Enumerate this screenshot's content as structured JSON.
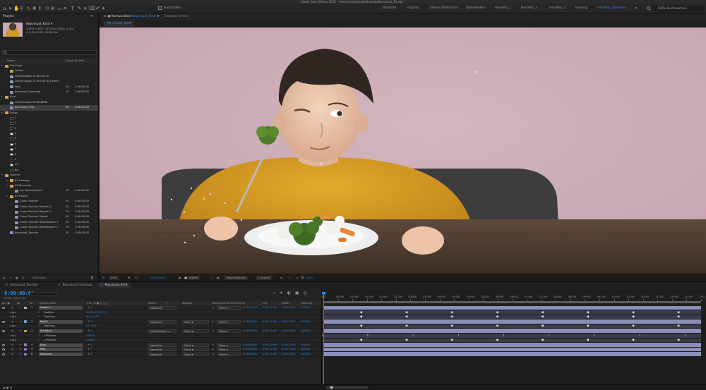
{
  "window": {
    "title": "Adobe After Effects 2020 - /Users/herbstmuth/Desktop/Keyvisual_20.aep *"
  },
  "toolbar": {
    "snapping_label": "Ausrichten",
    "workspaces": [
      "Standard",
      "Original",
      "Kleiner Bildschirm",
      "Bibliotheken",
      "HerbPro_1",
      "HerbPro_2",
      "HerbPro_3",
      "Training",
      "HerbPro_2Screens"
    ],
    "active_workspace": "HerbPro_2Screens",
    "more": "»",
    "help_placeholder": "Hilfe durchsuchen"
  },
  "project": {
    "tab_label": "Projekt",
    "menu": "≡",
    "selected_asset": {
      "name": "Keyvisual_Kind ▾",
      "dims": "10951 x 6017 (2729 x 1500) (1,00)",
      "duration": "Δ 0;00;13;00, 59,94 fps"
    },
    "columns": {
      "name": "Name",
      "fps": "Frame...",
      "start": "In-Point"
    },
    "rows": [
      {
        "label": "Flamingo",
        "type": "folder",
        "level": 0,
        "tri": "▾",
        "fps": "",
        "start": ""
      },
      {
        "label": "Farben",
        "type": "folder",
        "level": 1,
        "tri": "▸",
        "fps": "",
        "start": ""
      },
      {
        "label": "GettyImages-1176333140",
        "type": "image",
        "level": 1,
        "tri": "",
        "fps": "",
        "start": ""
      },
      {
        "label": "GettyImages-1176333140_Farben",
        "type": "image",
        "level": 1,
        "tri": "",
        "fps": "",
        "start": ""
      },
      {
        "label": "Hals",
        "type": "comp",
        "level": 1,
        "tri": "",
        "fps": "30",
        "start": "0:00:00:00"
      },
      {
        "label": "Keyvisual_Flamingo",
        "type": "comp",
        "level": 1,
        "tri": "",
        "fps": "30",
        "start": "0:00:00:00"
      },
      {
        "label": "Kind",
        "type": "folder",
        "level": 0,
        "tri": "▾",
        "fps": "",
        "start": ""
      },
      {
        "label": "GettyImages-904606666",
        "type": "image",
        "level": 1,
        "tri": "",
        "fps": "",
        "start": ""
      },
      {
        "label": "Keyvisual_Kind",
        "type": "comp",
        "level": 1,
        "tri": "",
        "fps": "30",
        "start": "0:00:00:00",
        "selected": true
      },
      {
        "label": "Solids",
        "type": "folder",
        "level": 0,
        "tri": "▾",
        "fps": "",
        "start": ""
      },
      {
        "label": "1",
        "type": "solid-dark",
        "level": 1,
        "tri": "",
        "fps": "",
        "start": ""
      },
      {
        "label": "2",
        "type": "solid-dark",
        "level": 1,
        "tri": "",
        "fps": "",
        "start": ""
      },
      {
        "label": "3",
        "type": "solid-dark",
        "level": 1,
        "tri": "",
        "fps": "",
        "start": ""
      },
      {
        "label": "4",
        "type": "solid-light",
        "level": 1,
        "tri": "",
        "fps": "",
        "start": ""
      },
      {
        "label": "5",
        "type": "solid-dark",
        "level": 1,
        "tri": "",
        "fps": "",
        "start": ""
      },
      {
        "label": "6",
        "type": "solid-light",
        "level": 1,
        "tri": "",
        "fps": "",
        "start": ""
      },
      {
        "label": "7",
        "type": "solid-light",
        "level": 1,
        "tri": "",
        "fps": "",
        "start": ""
      },
      {
        "label": "8",
        "type": "solid-light",
        "level": 1,
        "tri": "",
        "fps": "",
        "start": ""
      },
      {
        "label": "9",
        "type": "solid-dark",
        "level": 1,
        "tri": "",
        "fps": "",
        "start": ""
      },
      {
        "label": "10",
        "type": "solid-light",
        "level": 1,
        "tri": "",
        "fps": "",
        "start": ""
      },
      {
        "label": "BG",
        "type": "solid-dark",
        "level": 1,
        "tri": "",
        "fps": "",
        "start": ""
      },
      {
        "label": "Taucher",
        "type": "folder",
        "level": 0,
        "tri": "▾",
        "fps": "",
        "start": ""
      },
      {
        "label": "01 Footage",
        "type": "folder",
        "level": 1,
        "tri": "▸",
        "fps": "",
        "start": ""
      },
      {
        "label": "02 Elemente",
        "type": "folder",
        "level": 1,
        "tri": "▾",
        "fps": "",
        "start": ""
      },
      {
        "label": "Arc Wasserstrahl",
        "type": "comp",
        "level": 2,
        "tri": "",
        "fps": "30",
        "start": "0:00:00:00"
      },
      {
        "label": "03 Comps",
        "type": "folder",
        "level": 1,
        "tri": "▾",
        "fps": "",
        "start": ""
      },
      {
        "label": "Comp Taucher",
        "type": "comp",
        "level": 2,
        "tri": "",
        "fps": "30",
        "start": "0:00:00:00"
      },
      {
        "label": "Comp Taucher Ripples 1",
        "type": "comp",
        "level": 2,
        "tri": "",
        "fps": "30",
        "start": "0:00:00:00"
      },
      {
        "label": "Comp Taucher Ripples 2",
        "type": "comp",
        "level": 2,
        "tri": "",
        "fps": "30",
        "start": "0:00:00:00"
      },
      {
        "label": "Comp Taucher Splash",
        "type": "comp",
        "level": 2,
        "tri": "",
        "fps": "30",
        "start": "0:00:00:00"
      },
      {
        "label": "Comp Taucher Weisswasser 1",
        "type": "comp",
        "level": 2,
        "tri": "",
        "fps": "30",
        "start": "0:00:00:00"
      },
      {
        "label": "Comp Taucher Weisswasser 2",
        "type": "comp",
        "level": 2,
        "tri": "",
        "fps": "30",
        "start": "0:00:00:00"
      },
      {
        "label": "Keyvisual_Taucher",
        "type": "comp",
        "level": 1,
        "tri": "",
        "fps": "30",
        "start": "0:00:00:00"
      }
    ],
    "bpc": "8-Bit-Kanal"
  },
  "viewer": {
    "comp_tab_prefix": "Komposition",
    "comp_tab_name": "Keyvisual_Kind",
    "footage_tab": "Footage (ohne)",
    "comp_chip": "Keyvisual_Kind",
    "bar": {
      "zoom": "25%",
      "timecode": "0:00:00:00",
      "resolution": "Viertel",
      "camera": "Aktive Kamera",
      "views": "1 Ansicht",
      "exposure": "+0,0"
    }
  },
  "timeline": {
    "tabs": [
      {
        "label": "Keyvisual_Taucher",
        "active": false
      },
      {
        "label": "Keyvisual_Flamingo",
        "active": false
      },
      {
        "label": "Keyvisual_Kind",
        "active": true
      }
    ],
    "timecode": "0:00:00:00",
    "timecode_sub": "00000 (59,94 fps)",
    "header": {
      "num": "Nr.",
      "source": "Quellenname",
      "mode": "Modus",
      "trkmat": "BewMas",
      "parent": "Übergeordnet und verkn...",
      "in": "In",
      "out": "Out",
      "duration": "Dauer",
      "stretch": "Dehnung"
    },
    "ruler": [
      "00f",
      "00:20f",
      "01:00f",
      "01:20f",
      "02:00f",
      "02:20f",
      "03:00f",
      "03:20f",
      "04:00f",
      "04:20f",
      "05:00f",
      "05:20f",
      "06:00f",
      "06:20f",
      "07:00f",
      "07:20f",
      "08:00f",
      "08:20f",
      "09:00f",
      "09:20f",
      "10:00f",
      "10:20f",
      "11:00f",
      "11:20f",
      "12:00f",
      "12:20f",
      "13:0"
    ],
    "layers": [
      {
        "num": "1",
        "name": "Gabel 3",
        "color": "#b6b6b6",
        "mode": "Normal",
        "trkmat": "",
        "parent": "Ohne",
        "in": "0:00:00:00",
        "out": "0:00:12:49",
        "dur": "0:00:13:00",
        "stretch": "100,0%",
        "kind": "layer"
      },
      {
        "num": "",
        "name": "Position",
        "value": "10951,3, 3217,3",
        "kind": "prop"
      },
      {
        "num": "",
        "name": "Drehung",
        "value": "0x +11,0°",
        "kind": "prop"
      },
      {
        "num": "2",
        "name": "Kopf 2",
        "color": "#6aa0d0",
        "mode": "Normal",
        "trkmat": "Ohne",
        "parent": "Ohne",
        "in": "0:00:00:00",
        "out": "0:00:12:49",
        "dur": "0:00:13:00",
        "stretch": "100,0%",
        "kind": "layer"
      },
      {
        "num": "",
        "name": "Drehung",
        "value": "0x +0,0°",
        "kind": "prop"
      },
      {
        "num": "3",
        "name": "Schatten",
        "color": "#c9a04a",
        "mode": "Multiplizieren",
        "trkmat": "Ohne",
        "parent": "Ohne",
        "in": "0:00:00:00",
        "out": "0:00:12:49",
        "dur": "0:00:13:00",
        "stretch": "100,0%",
        "kind": "layer"
      },
      {
        "num": "",
        "name": "x Position",
        "value": "1593,0",
        "kind": "prop"
      },
      {
        "num": "",
        "name": "y Position",
        "value": "1568,0",
        "kind": "prop"
      },
      {
        "num": "4",
        "name": "Kind",
        "color": "#9b7ec4",
        "mode": "Normal",
        "trkmat": "Ohne",
        "parent": "Ohne",
        "in": "0:00:00:00",
        "out": "0:00:12:49",
        "dur": "0:00:13:00",
        "stretch": "100,0%",
        "kind": "layer"
      },
      {
        "num": "5",
        "name": "Pulli",
        "color": "#9b7ec4",
        "mode": "Normal",
        "trkmat": "Ohne",
        "parent": "Ohne",
        "in": "0:00:00:00",
        "out": "0:00:12:49",
        "dur": "0:00:13:00",
        "stretch": "100,0%",
        "kind": "layer"
      },
      {
        "num": "6",
        "name": "Retusche",
        "color": "#9b7ec4",
        "mode": "Normal",
        "trkmat": "Ohne",
        "parent": "Ohne",
        "in": "0:00:00:00",
        "out": "0:00:12:49",
        "dur": "0:00:13:00",
        "stretch": "100,0%",
        "kind": "layer"
      }
    ]
  },
  "colors": {
    "accent": "#2d8ceb",
    "panel": "#232323",
    "layer_bar": "#8b8fb7"
  }
}
